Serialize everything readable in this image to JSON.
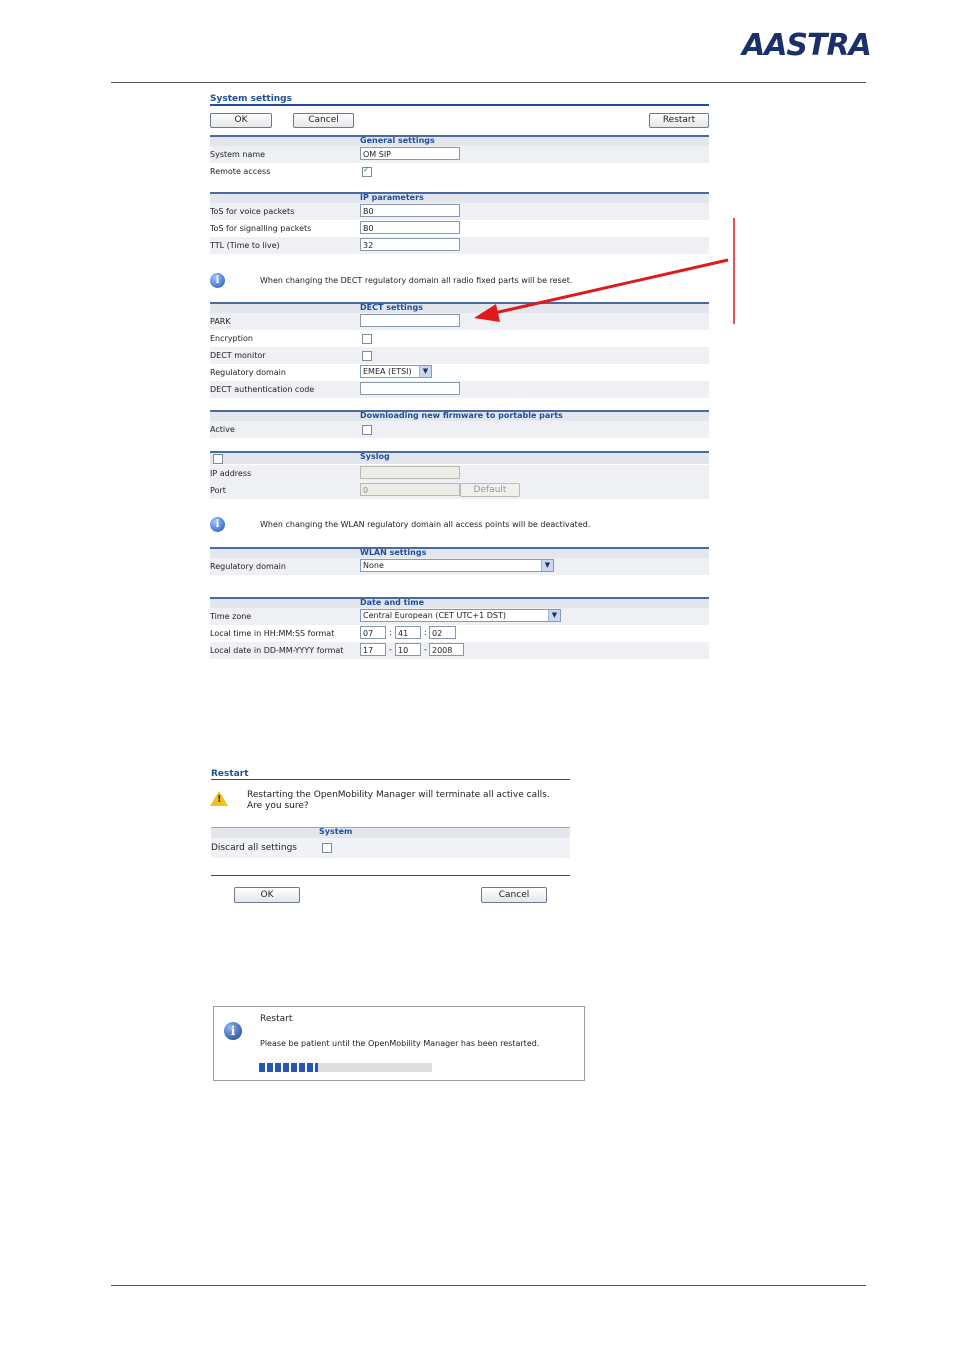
{
  "brand": {
    "logo_text": "AASTRA"
  },
  "system_settings": {
    "title": "System settings",
    "buttons": {
      "ok": "OK",
      "cancel": "Cancel",
      "restart": "Restart"
    },
    "general": {
      "header": "General settings",
      "system_name_label": "System name",
      "system_name_value": "OM SIP",
      "remote_access_label": "Remote access",
      "remote_access_checked": true
    },
    "ip": {
      "header": "IP parameters",
      "tos_voice_label": "ToS for voice packets",
      "tos_voice_value": "B0",
      "tos_signal_label": "ToS for signalling packets",
      "tos_signal_value": "B0",
      "ttl_label": "TTL (Time to live)",
      "ttl_value": "32"
    },
    "dect_note": "When changing the DECT regulatory domain all radio fixed parts will be reset.",
    "dect": {
      "header": "DECT settings",
      "park_label": "PARK",
      "park_value": "",
      "encryption_label": "Encryption",
      "monitor_label": "DECT monitor",
      "regdomain_label": "Regulatory domain",
      "regdomain_value": "EMEA (ETSI)",
      "auth_label": "DECT authentication code",
      "auth_value": ""
    },
    "firmware": {
      "header": "Downloading new firmware to portable parts",
      "active_label": "Active"
    },
    "syslog": {
      "header": "Syslog",
      "ip_label": "IP address",
      "port_label": "Port",
      "port_value": "0",
      "default_button": "Default"
    },
    "wlan_note": "When changing the WLAN regulatory domain all access points will be deactivated.",
    "wlan": {
      "header": "WLAN settings",
      "regdomain_label": "Regulatory domain",
      "regdomain_value": "None"
    },
    "datetime": {
      "header": "Date and time",
      "tz_label": "Time zone",
      "tz_value": "Central European (CET UTC+1 DST)",
      "time_label": "Local time in HH:MM:SS format",
      "hh": "07",
      "mm": "41",
      "ss": "02",
      "date_label": "Local date in DD-MM-YYYY format",
      "dd": "17",
      "mo": "10",
      "yyyy": "2008",
      "time_sep": ":",
      "date_sep": "-"
    }
  },
  "restart_dialog": {
    "title": "Restart",
    "warning_line1": "Restarting the OpenMobility Manager will terminate all active calls.",
    "warning_line2": "Are you sure?",
    "system_header": "System",
    "discard_label": "Discard all settings",
    "ok": "OK",
    "cancel": "Cancel"
  },
  "restart_progress": {
    "title": "Restart",
    "message": "Please be patient until the OpenMobility Manager has been restarted.",
    "progress_fraction": 0.34
  },
  "colors": {
    "accent": "#1f4f99",
    "arrow": "#e0191b",
    "progress": "#2357b8"
  }
}
